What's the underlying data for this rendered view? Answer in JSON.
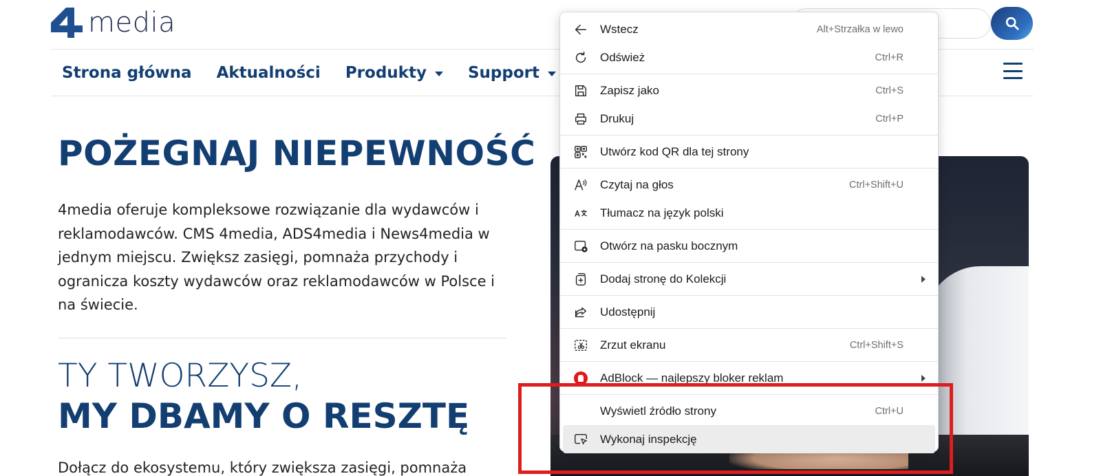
{
  "site": {
    "logo_text": "media",
    "nav": [
      {
        "label": "Strona główna",
        "dropdown": false
      },
      {
        "label": "Aktualności",
        "dropdown": false
      },
      {
        "label": "Produkty",
        "dropdown": true
      },
      {
        "label": "Support",
        "dropdown": true
      }
    ],
    "search_icon": "search-icon",
    "menu_icon": "hamburger-icon",
    "brand_color": "#123e72"
  },
  "hero": {
    "title": "POŻEGNAJ NIEPEWNOŚĆ",
    "body": "4media oferuje kompleksowe rozwiązanie dla wydawców i reklamodawców. CMS 4media, ADS4media i News4media w jednym miejscu. Zwiększ zasięgi, pomnaża przychody i ogranicza koszty wydawców oraz reklamodawców w Polsce i na świecie.",
    "tagline_line1": "TY TWORZYSZ,",
    "tagline_line2": "MY DBAMY O RESZTĘ",
    "join_text": "Dołącz do ekosystemu, który zwiększa zasięgi, pomnaża"
  },
  "context_menu": {
    "items": [
      {
        "label": "Wstecz",
        "shortcut": "Alt+Strzałka w lewo",
        "icon": "back-arrow-icon"
      },
      {
        "label": "Odśwież",
        "shortcut": "Ctrl+R",
        "icon": "refresh-icon"
      },
      {
        "label": "Zapisz jako",
        "shortcut": "Ctrl+S",
        "icon": "save-as-icon"
      },
      {
        "label": "Drukuj",
        "shortcut": "Ctrl+P",
        "icon": "print-icon"
      },
      {
        "label": "Utwórz kod QR dla tej strony",
        "shortcut": "",
        "icon": "qr-code-icon"
      },
      {
        "label": "Czytaj na głos",
        "shortcut": "Ctrl+Shift+U",
        "icon": "read-aloud-icon"
      },
      {
        "label": "Tłumacz na język polski",
        "shortcut": "",
        "icon": "translate-icon"
      },
      {
        "label": "Otwórz na pasku bocznym",
        "shortcut": "",
        "icon": "sidebar-icon"
      },
      {
        "label": "Dodaj stronę do Kolekcji",
        "shortcut": "",
        "icon": "collections-icon",
        "submenu": true
      },
      {
        "label": "Udostępnij",
        "shortcut": "",
        "icon": "share-icon"
      },
      {
        "label": "Zrzut ekranu",
        "shortcut": "Ctrl+Shift+S",
        "icon": "screenshot-icon"
      },
      {
        "label": "AdBlock — najlepszy bloker reklam",
        "shortcut": "",
        "icon": "adblock-icon",
        "submenu": true
      },
      {
        "label": "Wyświetl źródło strony",
        "shortcut": "Ctrl+U",
        "icon": ""
      },
      {
        "label": "Wykonaj inspekcję",
        "shortcut": "",
        "icon": "inspect-icon",
        "highlighted": true
      }
    ]
  },
  "annotation": {
    "color": "#dc1e1e"
  }
}
